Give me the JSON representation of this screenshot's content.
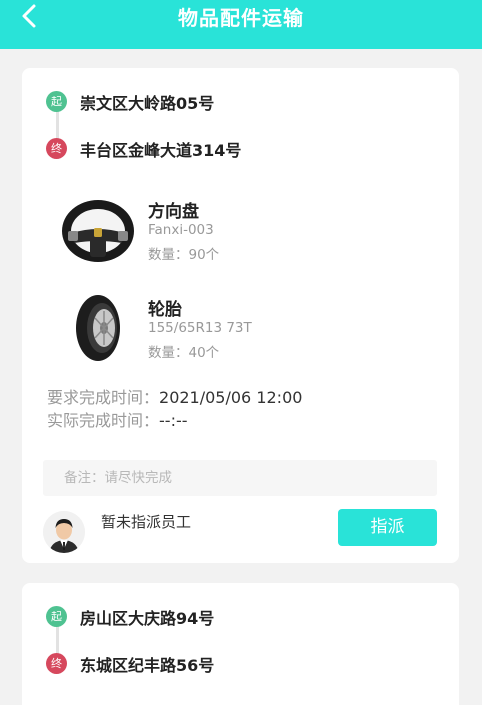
{
  "header": {
    "title": "物品配件运输"
  },
  "orders": [
    {
      "start_badge": "起",
      "end_badge": "终",
      "start_address": "崇文区大岭路05号",
      "end_address": "丰台区金峰大道314号",
      "items": [
        {
          "name": "方向盘",
          "model": "Fanxi-003",
          "qty": "数量：90个",
          "icon": "steering-wheel-icon"
        },
        {
          "name": "轮胎",
          "model": "155/65R13 73T",
          "qty": "数量：40个",
          "icon": "tire-icon"
        }
      ],
      "required_label": "要求完成时间：",
      "required_time": "2021/05/06 12:00",
      "actual_label": "实际完成时间：",
      "actual_time": "--:--",
      "note": "备注：请尽快完成",
      "assignee": "暂未指派员工",
      "assign_button": "指派"
    },
    {
      "start_badge": "起",
      "end_badge": "终",
      "start_address": "房山区大庆路94号",
      "end_address": "东城区纪丰路56号"
    }
  ],
  "colors": {
    "accent": "#29e3d8",
    "start": "#4fc291",
    "end": "#d6485d"
  }
}
